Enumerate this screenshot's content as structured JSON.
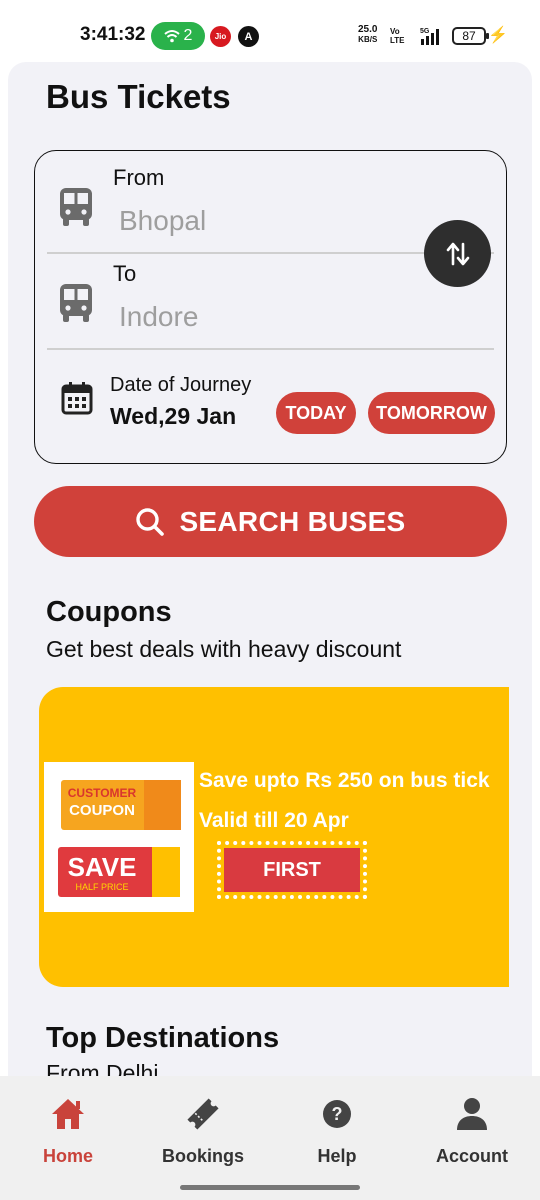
{
  "status_bar": {
    "time": "3:41:32",
    "wifi_count": "2",
    "jio_label": "Jio",
    "a_label": "A",
    "net_speed": "25.0",
    "net_speed_unit": "KB/S",
    "volte": "Vo LTE",
    "network": "5G",
    "battery": "87"
  },
  "page": {
    "title": "Bus Tickets"
  },
  "search": {
    "from_label": "From",
    "from_value": "Bhopal",
    "to_label": "To",
    "to_value": "Indore",
    "date_label": "Date of Journey",
    "date_value": "Wed,29 Jan",
    "today_label": "TODAY",
    "tomorrow_label": "TOMORROW",
    "button_label": "SEARCH BUSES"
  },
  "coupons": {
    "title": "Coupons",
    "subtitle": "Get best deals with heavy discount",
    "banner_line1": "Save upto Rs 250 on bus tick",
    "banner_line2": "Valid till 20 Apr",
    "code": "FIRST",
    "image_text": {
      "customer": "CUSTOMER",
      "coupon": "COUPON",
      "save": "SAVE",
      "half_price": "HALF PRICE"
    }
  },
  "destinations": {
    "title": "Top Destinations",
    "subtitle": "From Delhi"
  },
  "nav": [
    {
      "label": "Home",
      "icon": "home-icon"
    },
    {
      "label": "Bookings",
      "icon": "ticket-icon"
    },
    {
      "label": "Help",
      "icon": "help-icon"
    },
    {
      "label": "Account",
      "icon": "account-icon"
    }
  ],
  "colors": {
    "accent": "#d0413a",
    "banner": "#ffc000",
    "background": "#f2f2f7"
  }
}
